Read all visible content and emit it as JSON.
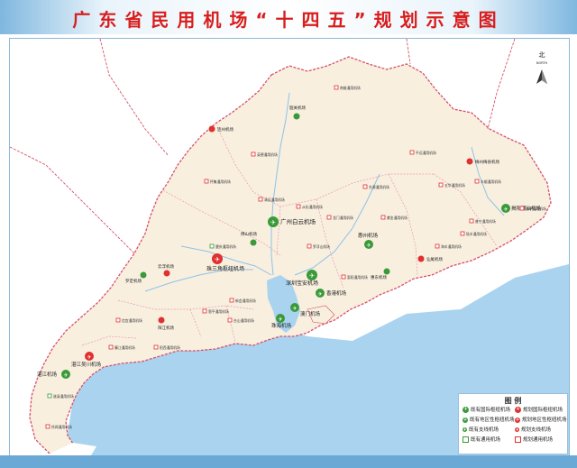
{
  "title": "广东省民用机场“十四五”规划示意图",
  "north_label": "北",
  "north_sub": "NORTH",
  "colors": {
    "sea": "#a9d3ef",
    "land": "#f8efdf",
    "outside": "#ffffff",
    "boundary_province": "#d8506a",
    "boundary_city": "#ea9aae",
    "river": "#8fc2e8",
    "existing": "#3a9a3a",
    "planned": "#e03030"
  },
  "airports": [
    {
      "name": "广州白云机场",
      "kind": "hub-existing"
    },
    {
      "name": "深圳宝安机场",
      "kind": "hub-existing"
    },
    {
      "name": "珠三角枢纽机场",
      "kind": "hub-planned"
    },
    {
      "name": "揭阳潮汕机场",
      "kind": "regional-existing"
    },
    {
      "name": "湛江吴川机场",
      "kind": "regional-planned"
    },
    {
      "name": "湛江机场",
      "kind": "regional-existing"
    },
    {
      "name": "惠州机场",
      "kind": "regional-existing"
    },
    {
      "name": "珠海机场",
      "kind": "regional-existing"
    },
    {
      "name": "香港机场",
      "kind": "regional-existing"
    },
    {
      "name": "澳门机场",
      "kind": "regional-existing"
    },
    {
      "name": "韶关机场",
      "kind": "branch-existing"
    },
    {
      "name": "梅州梅县机场",
      "kind": "branch-planned"
    },
    {
      "name": "连州机场",
      "kind": "branch-planned"
    },
    {
      "name": "云浮机场",
      "kind": "branch-planned"
    },
    {
      "name": "阳江机场",
      "kind": "branch-planned"
    },
    {
      "name": "汕尾机场",
      "kind": "branch-planned"
    },
    {
      "name": "罗定机场",
      "kind": "branch-existing"
    },
    {
      "name": "佛山机场",
      "kind": "branch-existing"
    },
    {
      "name": "惠东机场",
      "kind": "branch-existing"
    }
  ],
  "ga_airports": [
    "南雄通用机场",
    "英德通用机场",
    "丰顺通用机场",
    "罗浮山机场",
    "东源通用机场",
    "信宜通用机场",
    "阳西通用机场",
    "徐闻通用机场",
    "恩平通用机场",
    "台山通用机场",
    "惠阳通用机场",
    "平远通用机场",
    "陆丰通用机场",
    "饶平通用机场",
    "新会通用机场",
    "肇庆通用机场",
    "怀集通用机场",
    "清远通用机场",
    "从化通用机场",
    "龙门通用机场",
    "紫金通用机场",
    "五华通用机场",
    "普宁通用机场",
    "海丰通用机场",
    "廉江通用机场",
    "遂溪通用机场"
  ],
  "legend": {
    "title": "图 例",
    "items": [
      "既有国际枢纽机场",
      "规划国际枢纽机场",
      "既有地区性枢纽机场",
      "规划地区性枢纽机场",
      "既有支线机场",
      "规划支线机场",
      "既有通用机场",
      "规划通用机场"
    ]
  }
}
